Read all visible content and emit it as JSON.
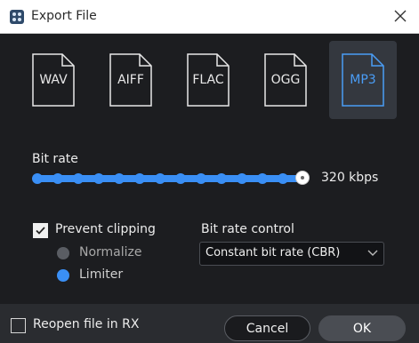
{
  "window": {
    "title": "Export File",
    "app_icon": "app-icon",
    "close_icon": "close-icon"
  },
  "formats": [
    {
      "label": "WAV",
      "selected": false
    },
    {
      "label": "AIFF",
      "selected": false
    },
    {
      "label": "FLAC",
      "selected": false
    },
    {
      "label": "OGG",
      "selected": false
    },
    {
      "label": "MP3",
      "selected": true
    }
  ],
  "bitrate": {
    "label": "Bit rate",
    "value_text": "320 kbps",
    "position": 1.0
  },
  "prevent_clipping": {
    "label": "Prevent clipping",
    "checked": true,
    "options": [
      {
        "label": "Normalize",
        "selected": false
      },
      {
        "label": "Limiter",
        "selected": true
      }
    ]
  },
  "bitrate_control": {
    "label": "Bit rate control",
    "selected": "Constant bit rate (CBR)"
  },
  "footer": {
    "reopen_label": "Reopen file in RX",
    "reopen_checked": false,
    "cancel_label": "Cancel",
    "ok_label": "OK"
  },
  "colors": {
    "accent": "#3a8ff5",
    "background": "#1c1d20",
    "selected_tile": "#34383f"
  }
}
